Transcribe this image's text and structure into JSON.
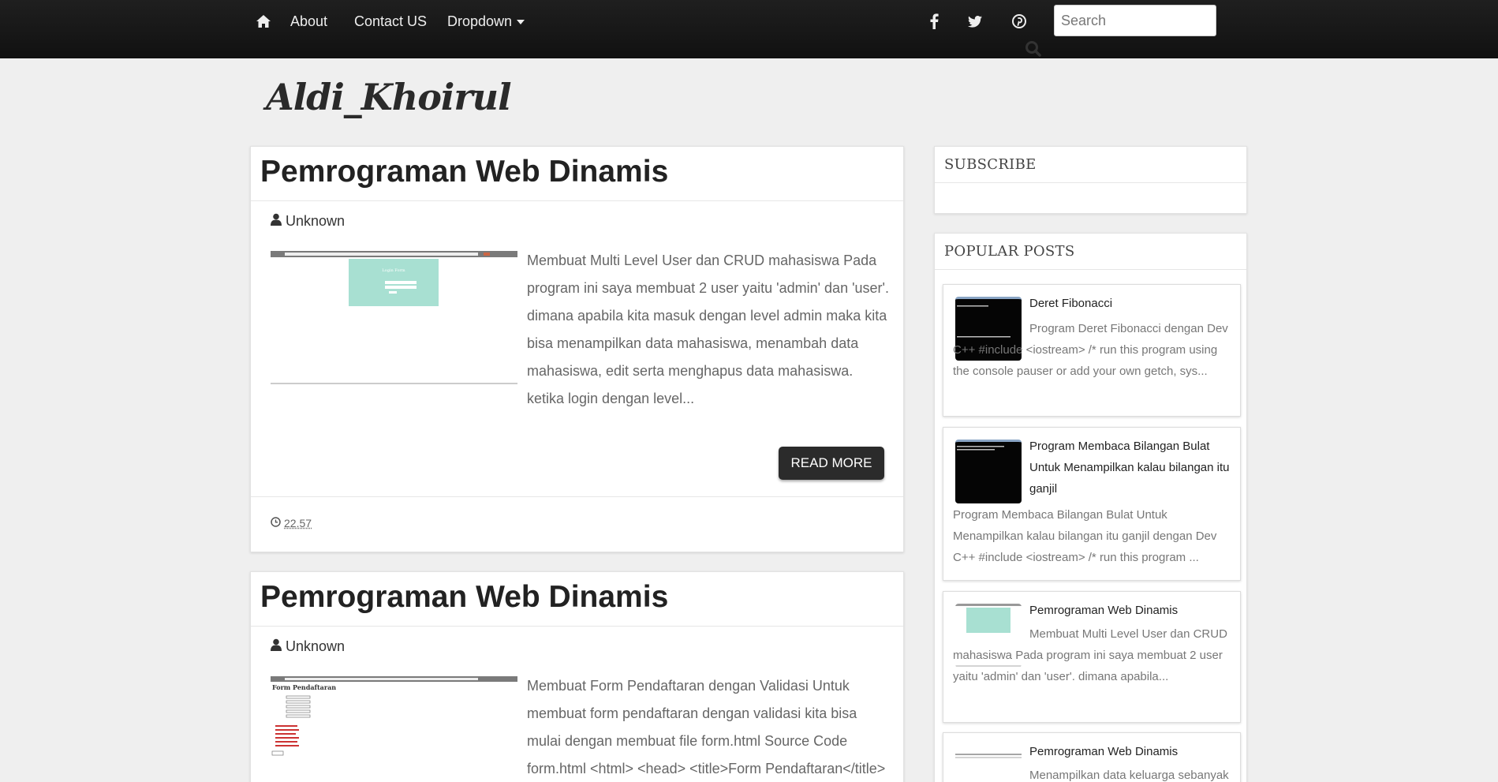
{
  "nav": {
    "items": [
      {
        "label": "About"
      },
      {
        "label": "Contact US"
      },
      {
        "label": "Dropdown"
      }
    ],
    "search_placeholder": "Search"
  },
  "blog": {
    "title": "Aldi_Khoirul"
  },
  "posts": [
    {
      "title": "Pemrograman Web Dinamis",
      "author": "Unknown",
      "thumb_heading": "Login Form",
      "snippet": "Membuat Multi Level User dan CRUD mahasiswa Pada program ini saya membuat 2 user yaitu 'admin' dan 'user'. dimana apabila kita masuk dengan level admin maka kita bisa menampilkan data mahasiswa, menambah data mahasiswa, edit serta menghapus data mahasiswa. ketika login dengan level...",
      "read_more": "READ MORE",
      "time": "22.57"
    },
    {
      "title": "Pemrograman Web Dinamis",
      "author": "Unknown",
      "thumb_heading": "Form Pendaftaran",
      "snippet": "Membuat Form Pendaftaran dengan Validasi Untuk membuat form pendaftaran dengan validasi kita bisa mulai dengan membuat file form.html Source Code form.html <html> <head> <title>Form Pendaftaran</title>"
    }
  ],
  "sidebar": {
    "subscribe_title": "SUBSCRIBE",
    "popular_title": "POPULAR POSTS",
    "popular": [
      {
        "title": "Deret Fibonacci",
        "snippet": "Program Deret Fibonacci dengan Dev C++ #include <iostream> /* run this program using the console pauser or add your own getch, sys..."
      },
      {
        "title": "Program Membaca Bilangan Bulat Untuk Menampilkan kalau bilangan itu ganjil",
        "snippet": "Program Membaca Bilangan Bulat Untuk Menampilkan kalau bilangan itu ganjil dengan Dev C++ #include <iostream> /* run this program ..."
      },
      {
        "title": "Pemrograman Web Dinamis",
        "snippet": "Membuat Multi Level User dan CRUD mahasiswa Pada program ini saya membuat 2 user yaitu 'admin' dan 'user'. dimana apabila..."
      },
      {
        "title": "Pemrograman Web Dinamis",
        "snippet": "Menampilkan data keluarga sebanyak"
      }
    ]
  },
  "colors": {
    "navbar": "#151515",
    "button": "#2b2b2b",
    "page_bg": "#efefef"
  }
}
